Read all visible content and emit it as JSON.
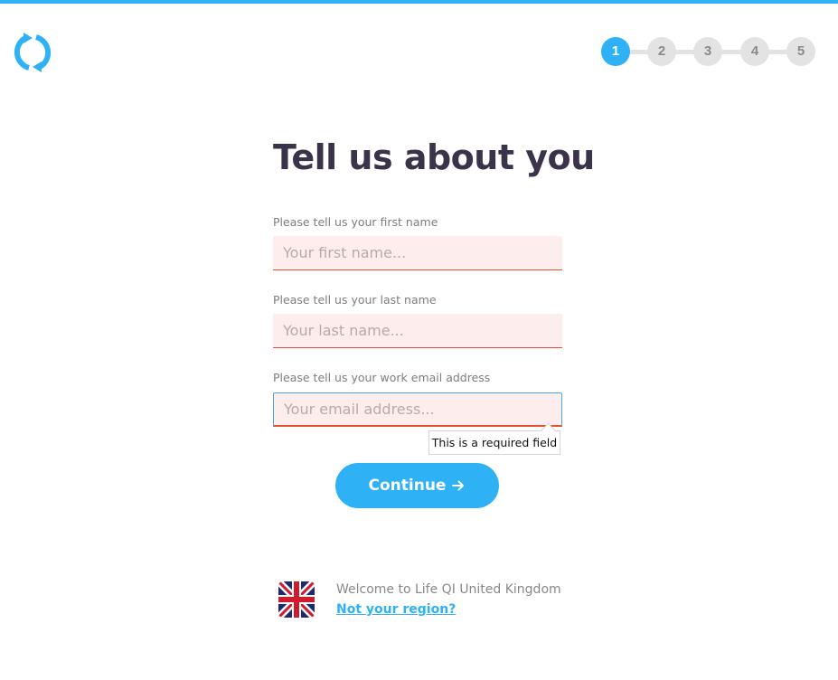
{
  "brand": {
    "logo_icon": "lifeqi-refresh-logo",
    "accent_color": "#2eb1f5"
  },
  "stepper": {
    "current": 1,
    "steps": [
      {
        "label": "1",
        "active": true
      },
      {
        "label": "2",
        "active": false
      },
      {
        "label": "3",
        "active": false
      },
      {
        "label": "4",
        "active": false
      },
      {
        "label": "5",
        "active": false
      }
    ]
  },
  "form": {
    "title": "Tell us about you",
    "first_name": {
      "label": "Please tell us your first name",
      "placeholder": "Your first name...",
      "value": ""
    },
    "last_name": {
      "label": "Please tell us your last name",
      "placeholder": "Your last name...",
      "value": ""
    },
    "email": {
      "label": "Please tell us your work email address",
      "placeholder": "Your email address...",
      "value": ""
    },
    "validation_message": "This is a required field",
    "continue_label": "Continue",
    "continue_icon": "arrow-right-icon"
  },
  "region": {
    "flag_icon": "uk-flag-icon",
    "welcome_text": "Welcome to Life QI United Kingdom",
    "link_text": "Not your region?"
  }
}
